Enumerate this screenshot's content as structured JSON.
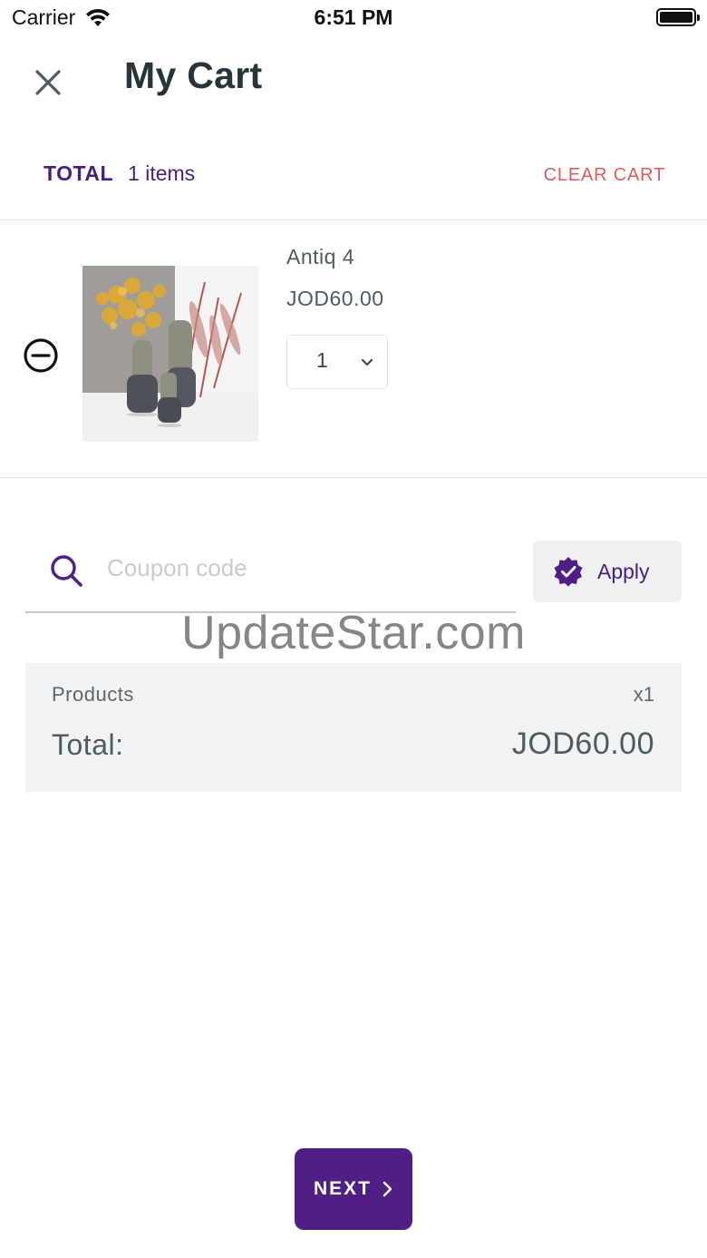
{
  "status_bar": {
    "carrier": "Carrier",
    "time": "6:51 PM"
  },
  "header": {
    "title": "My Cart"
  },
  "summary": {
    "total_label": "TOTAL",
    "items_count": "1 items",
    "clear_cart_label": "CLEAR CART"
  },
  "cart_items": [
    {
      "name": "Antiq 4",
      "price": "JOD60.00",
      "quantity": "1"
    }
  ],
  "coupon": {
    "placeholder": "Coupon code",
    "value": "",
    "apply_label": "Apply"
  },
  "watermark": "UpdateStar.com",
  "totals": {
    "products_label": "Products",
    "products_qty": "x1",
    "total_label": "Total:",
    "total_amount": "JOD60.00"
  },
  "footer": {
    "next_label": "NEXT"
  },
  "colors": {
    "brand_purple": "#4f1f85",
    "accent_red": "#e0595c",
    "panel_gray": "#f0f2f4"
  }
}
